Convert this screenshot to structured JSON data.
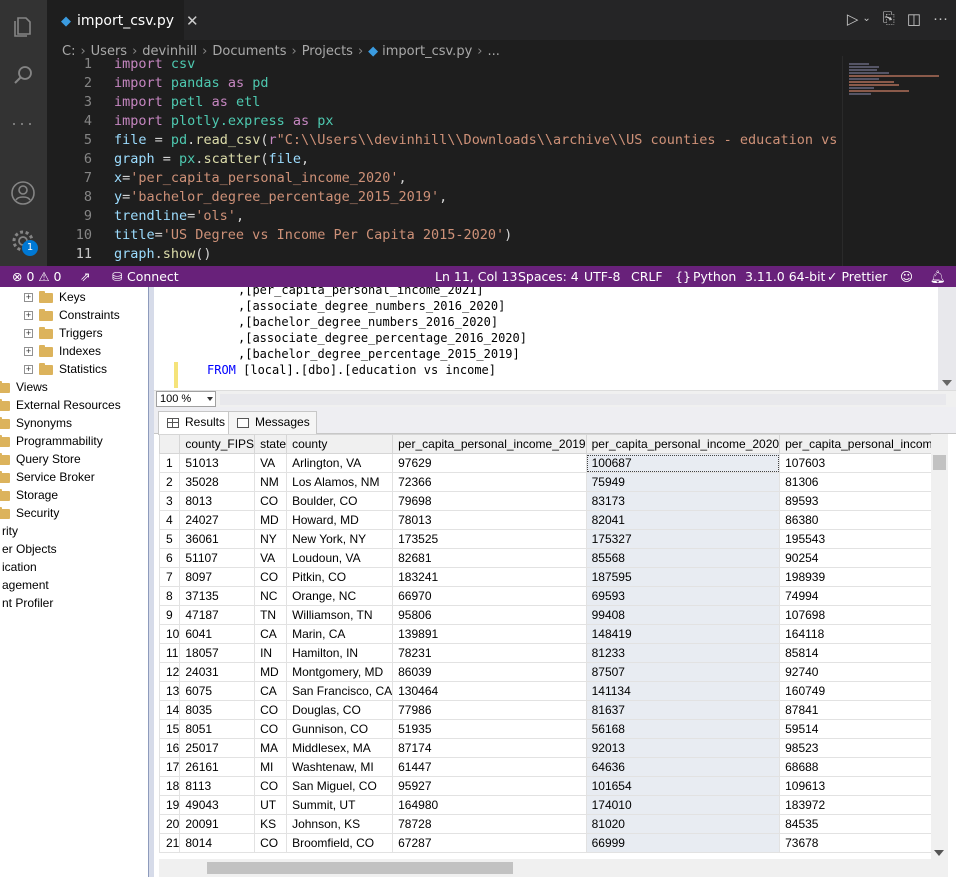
{
  "vscode": {
    "tab": {
      "filename": "import_csv.py"
    },
    "activity_badge": "1",
    "breadcrumb": [
      "C:",
      "Users",
      "devinhill",
      "Documents",
      "Projects",
      "import_csv.py",
      "..."
    ],
    "code_lines": [
      {
        "n": "1",
        "html": "<span class=\"kw\">import</span> <span class=\"mod\">csv</span>"
      },
      {
        "n": "2",
        "html": "<span class=\"kw\">import</span> <span class=\"mod\">pandas</span> <span class=\"kw\">as</span> <span class=\"mod\">pd</span>"
      },
      {
        "n": "3",
        "html": "<span class=\"kw\">import</span> <span class=\"mod\">petl</span> <span class=\"kw\">as</span> <span class=\"mod\">etl</span>"
      },
      {
        "n": "4",
        "html": "<span class=\"kw\">import</span> <span class=\"mod\">plotly.express</span> <span class=\"kw\">as</span> <span class=\"mod\">px</span>"
      },
      {
        "n": "5",
        "html": "<span class=\"id\">file</span> = <span class=\"mod\">pd</span>.<span class=\"fn\">read_csv</span>(<span class=\"kw\">r</span><span class=\"str\">\"C:\\\\Users\\\\devinhill\\\\Downloads\\\\archive\\\\US counties - education vs per capita</span>"
      },
      {
        "n": "6",
        "html": "<span class=\"id\">graph</span> = <span class=\"mod\">px</span>.<span class=\"fn\">scatter</span>(<span class=\"id\">file</span>,"
      },
      {
        "n": "7",
        "html": "<span class=\"id\">x</span>=<span class=\"str\">'per_capita_personal_income_2020'</span>,"
      },
      {
        "n": "8",
        "html": "<span class=\"id\">y</span>=<span class=\"str\">'bachelor_degree_percentage_2015_2019'</span>,"
      },
      {
        "n": "9",
        "html": "<span class=\"id\">trendline</span>=<span class=\"str\">'ols'</span>,"
      },
      {
        "n": "10",
        "html": "<span class=\"id\">title</span>=<span class=\"str\">'US Degree vs Income Per Capita 2015-2020'</span>)"
      },
      {
        "n": "11",
        "html": "<span class=\"id\">graph</span>.<span class=\"fn\">show</span>()"
      }
    ]
  },
  "statusbar": {
    "problems": "⊗ 0 ⚠ 0",
    "connect": "Connect",
    "position": "Ln 11, Col 13",
    "spaces": "Spaces: 4",
    "encoding": "UTF-8",
    "eol": "CRLF",
    "language": "Python",
    "interpreter": "3.11.0 64-bit",
    "prettier": "✓ Prettier"
  },
  "explorer": {
    "sub_items": [
      "Keys",
      "Constraints",
      "Triggers",
      "Indexes",
      "Statistics"
    ],
    "items": [
      "Views",
      "External Resources",
      "Synonyms",
      "Programmability",
      "Query Store",
      "Service Broker",
      "Storage",
      "Security"
    ],
    "truncated": [
      "rity",
      "er Objects",
      "ication",
      "agement",
      "nt Profiler"
    ]
  },
  "sql": {
    "lines": [
      ",[per_capita_personal_income_2021]",
      ",[associate_degree_numbers_2016_2020]",
      ",[bachelor_degree_numbers_2016_2020]",
      ",[associate_degree_percentage_2016_2020]",
      ",[bachelor_degree_percentage_2015_2019]"
    ],
    "from_kw": "FROM",
    "from_rest": " [local].[dbo].[education vs income]"
  },
  "zoom": "100 %",
  "results": {
    "tab_results": "Results",
    "tab_messages": "Messages",
    "columns": [
      "",
      "county_FIPS",
      "state",
      "county",
      "per_capita_personal_income_2019",
      "per_capita_personal_income_2020",
      "per_capita_personal_income_"
    ],
    "rows": [
      [
        "1",
        "51013",
        "VA",
        "Arlington, VA",
        "97629",
        "100687",
        "107603"
      ],
      [
        "2",
        "35028",
        "NM",
        "Los Alamos, NM",
        "72366",
        "75949",
        "81306"
      ],
      [
        "3",
        "8013",
        "CO",
        "Boulder, CO",
        "79698",
        "83173",
        "89593"
      ],
      [
        "4",
        "24027",
        "MD",
        "Howard, MD",
        "78013",
        "82041",
        "86380"
      ],
      [
        "5",
        "36061",
        "NY",
        "New York, NY",
        "173525",
        "175327",
        "195543"
      ],
      [
        "6",
        "51107",
        "VA",
        "Loudoun, VA",
        "82681",
        "85568",
        "90254"
      ],
      [
        "7",
        "8097",
        "CO",
        "Pitkin, CO",
        "183241",
        "187595",
        "198939"
      ],
      [
        "8",
        "37135",
        "NC",
        "Orange, NC",
        "66970",
        "69593",
        "74994"
      ],
      [
        "9",
        "47187",
        "TN",
        "Williamson, TN",
        "95806",
        "99408",
        "107698"
      ],
      [
        "10",
        "6041",
        "CA",
        "Marin, CA",
        "139891",
        "148419",
        "164118"
      ],
      [
        "11",
        "18057",
        "IN",
        "Hamilton, IN",
        "78231",
        "81233",
        "85814"
      ],
      [
        "12",
        "24031",
        "MD",
        "Montgomery, MD",
        "86039",
        "87507",
        "92740"
      ],
      [
        "13",
        "6075",
        "CA",
        "San Francisco, CA",
        "130464",
        "141134",
        "160749"
      ],
      [
        "14",
        "8035",
        "CO",
        "Douglas, CO",
        "77986",
        "81637",
        "87841"
      ],
      [
        "15",
        "8051",
        "CO",
        "Gunnison, CO",
        "51935",
        "56168",
        "59514"
      ],
      [
        "16",
        "25017",
        "MA",
        "Middlesex, MA",
        "87174",
        "92013",
        "98523"
      ],
      [
        "17",
        "26161",
        "MI",
        "Washtenaw, MI",
        "61447",
        "64636",
        "68688"
      ],
      [
        "18",
        "8113",
        "CO",
        "San Miguel, CO",
        "95927",
        "101654",
        "109613"
      ],
      [
        "19",
        "49043",
        "UT",
        "Summit, UT",
        "164980",
        "174010",
        "183972"
      ],
      [
        "20",
        "20091",
        "KS",
        "Johnson, KS",
        "78728",
        "81020",
        "84535"
      ],
      [
        "21",
        "8014",
        "CO",
        "Broomfield, CO",
        "67287",
        "66999",
        "73678"
      ]
    ]
  }
}
